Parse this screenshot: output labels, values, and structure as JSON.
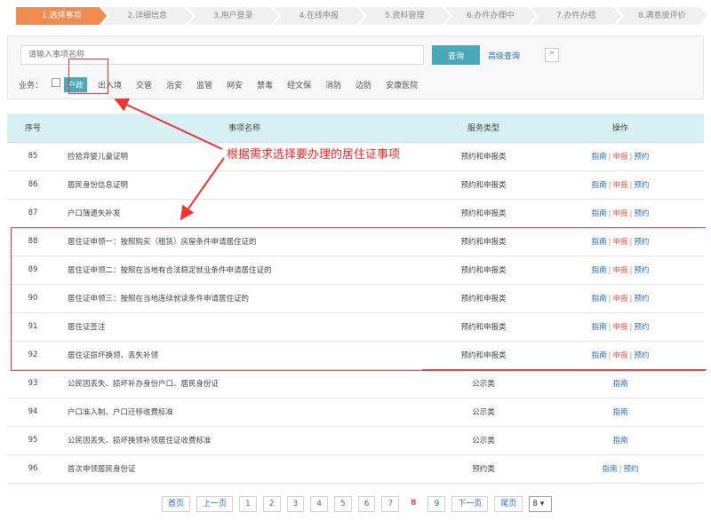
{
  "steps": [
    "1.选择事项",
    "2.详细信息",
    "3.用户登录",
    "4.在线申报",
    "5.资料管理",
    "6.办件办理中",
    "7.办件办结",
    "8.满意度评价"
  ],
  "search": {
    "placeholder": "请输入事项名称",
    "search_label": "查询",
    "advanced_label": "高级查询",
    "toggle_icon": "^"
  },
  "business": {
    "label": "业务：",
    "items": [
      "户政",
      "出入境",
      "交管",
      "治安",
      "监管",
      "网安",
      "禁毒",
      "经文保",
      "消防",
      "边防",
      "安康医院"
    ],
    "selected_index": 0
  },
  "table": {
    "headers": [
      "序号",
      "事项名称",
      "服务类型",
      "操作"
    ],
    "rows": [
      {
        "no": "85",
        "name": "捡拾弃婴儿童证明",
        "type": "预约和申报类",
        "ops": [
          "指南",
          "申报",
          "预约"
        ]
      },
      {
        "no": "86",
        "name": "居民身份信息证明",
        "type": "预约和申报类",
        "ops": [
          "指南",
          "申报",
          "预约"
        ]
      },
      {
        "no": "87",
        "name": "户口簿遗失补发",
        "type": "预约和申报类",
        "ops": [
          "指南",
          "申报",
          "预约"
        ]
      },
      {
        "no": "88",
        "name": "居住证申领一：按照购买（租赁）房屋条件申请居住证的",
        "type": "预约和申报类",
        "ops": [
          "指南",
          "申报",
          "预约"
        ]
      },
      {
        "no": "89",
        "name": "居住证申领二：按照在当地有合法稳定就业条件申请居住证的",
        "type": "预约和申报类",
        "ops": [
          "指南",
          "申报",
          "预约"
        ]
      },
      {
        "no": "90",
        "name": "居住证申领三：按照在当地连续就读条件申请居住证的",
        "type": "预约和申报类",
        "ops": [
          "指南",
          "申报",
          "预约"
        ]
      },
      {
        "no": "91",
        "name": "居住证签注",
        "type": "预约和申报类",
        "ops": [
          "指南",
          "申报",
          "预约"
        ]
      },
      {
        "no": "92",
        "name": "居住证损坏换领、丢失补领",
        "type": "预约和申报类",
        "ops": [
          "指南",
          "申报",
          "预约"
        ]
      },
      {
        "no": "93",
        "name": "公民因丢失、损坏补办身份户口、居民身份证",
        "type": "公示类",
        "ops": [
          "指南"
        ]
      },
      {
        "no": "94",
        "name": "户口准入制、户口迁移收费标准",
        "type": "公示类",
        "ops": [
          "指南"
        ]
      },
      {
        "no": "95",
        "name": "公民因丢失、损坏换领补领居住证收费标准",
        "type": "公示类",
        "ops": [
          "指南"
        ]
      },
      {
        "no": "96",
        "name": "首次申领居民身份证",
        "type": "预约类",
        "ops": [
          "指南",
          "预约"
        ]
      }
    ]
  },
  "annotation": "根据需求选择要办理的居住证事项",
  "pager": {
    "first": "首页",
    "prev": "上一页",
    "pages": [
      "1",
      "2",
      "3",
      "4",
      "5",
      "6",
      "7",
      "8",
      "9"
    ],
    "current": "8",
    "next": "下一页",
    "last": "尾页",
    "select_value": "8 ▾"
  },
  "colors": {
    "accent": "#4aa8b8",
    "step_active": "#f08c52",
    "annotation": "#e22",
    "link": "#2a6fb0"
  }
}
